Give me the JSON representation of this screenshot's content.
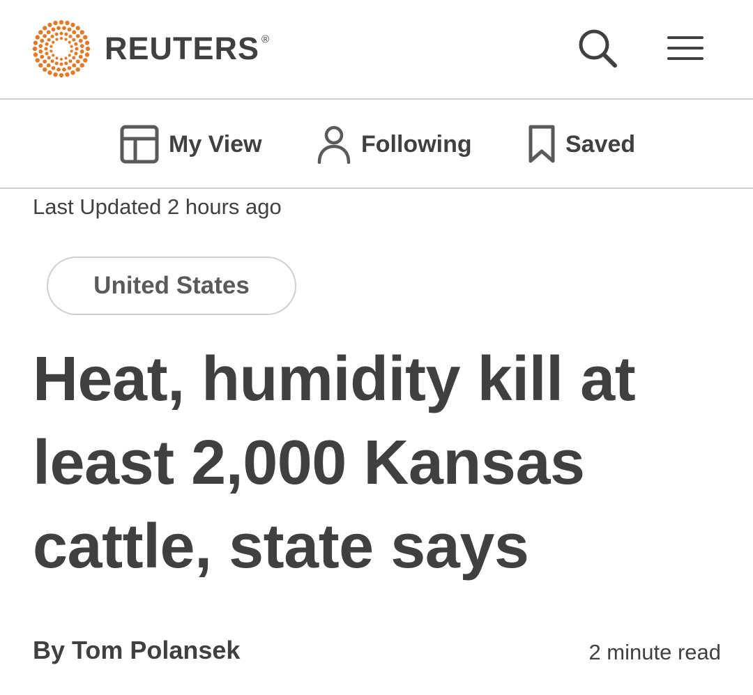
{
  "header": {
    "brand": "REUTERS",
    "registered_mark": "®",
    "logo_icon": "reuters-dot-logo",
    "search_icon": "search-icon",
    "menu_icon": "hamburger-menu-icon"
  },
  "subnav": {
    "items": [
      {
        "label": "My View",
        "icon": "layout-icon"
      },
      {
        "label": "Following",
        "icon": "person-icon"
      },
      {
        "label": "Saved",
        "icon": "bookmark-icon"
      }
    ]
  },
  "article": {
    "last_updated": "Last Updated 2 hours ago",
    "tag": "United States",
    "headline": "Heat, humidity kill at least 2,000 Kansas cattle, state says",
    "byline_prefix": "By",
    "author": "Tom Polansek",
    "read_time": "2 minute read"
  },
  "colors": {
    "brand_orange": "#E87722",
    "text": "#404040",
    "divider": "#D0D0D0"
  }
}
